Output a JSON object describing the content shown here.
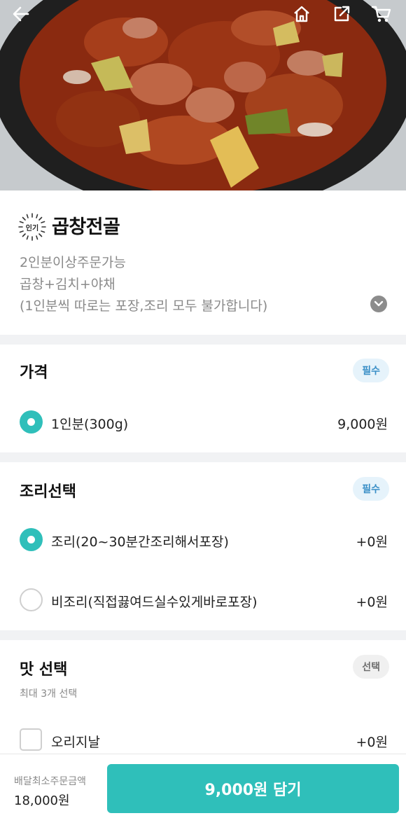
{
  "header": {
    "icons": [
      "back-arrow-icon",
      "home-icon",
      "share-icon",
      "cart-icon"
    ]
  },
  "product": {
    "badge": "인기",
    "name": "곱창전골",
    "desc1": "2인분이상주문가능",
    "desc2": "곱창+김치+야채",
    "desc3": "(1인분씩 따로는 포장,조리 모두 불가합니다)"
  },
  "price_section": {
    "title": "가격",
    "tag": "필수",
    "options": [
      {
        "label": "1인분(300g)",
        "price": "9,000원",
        "selected": true
      }
    ]
  },
  "cook_section": {
    "title": "조리선택",
    "tag": "필수",
    "options": [
      {
        "label": "조리(20~30분간조리해서포장)",
        "price": "+0원",
        "selected": true
      },
      {
        "label": "비조리(직접끓여드실수있게바로포장)",
        "price": "+0원",
        "selected": false
      }
    ]
  },
  "taste_section": {
    "title": "맛 선택",
    "tag": "선택",
    "subtitle": "최대 3개 선택",
    "options": [
      {
        "label": "오리지날",
        "price": "+0원",
        "checked": false
      }
    ]
  },
  "bottom_bar": {
    "min_order_label": "배달최소주문금액",
    "min_order_value": "18,000원",
    "add_button": "9,000원 담기"
  },
  "colors": {
    "accent": "#2fbfba",
    "required_tag_bg": "#e6f3fb",
    "required_tag_text": "#3a8fc7"
  }
}
